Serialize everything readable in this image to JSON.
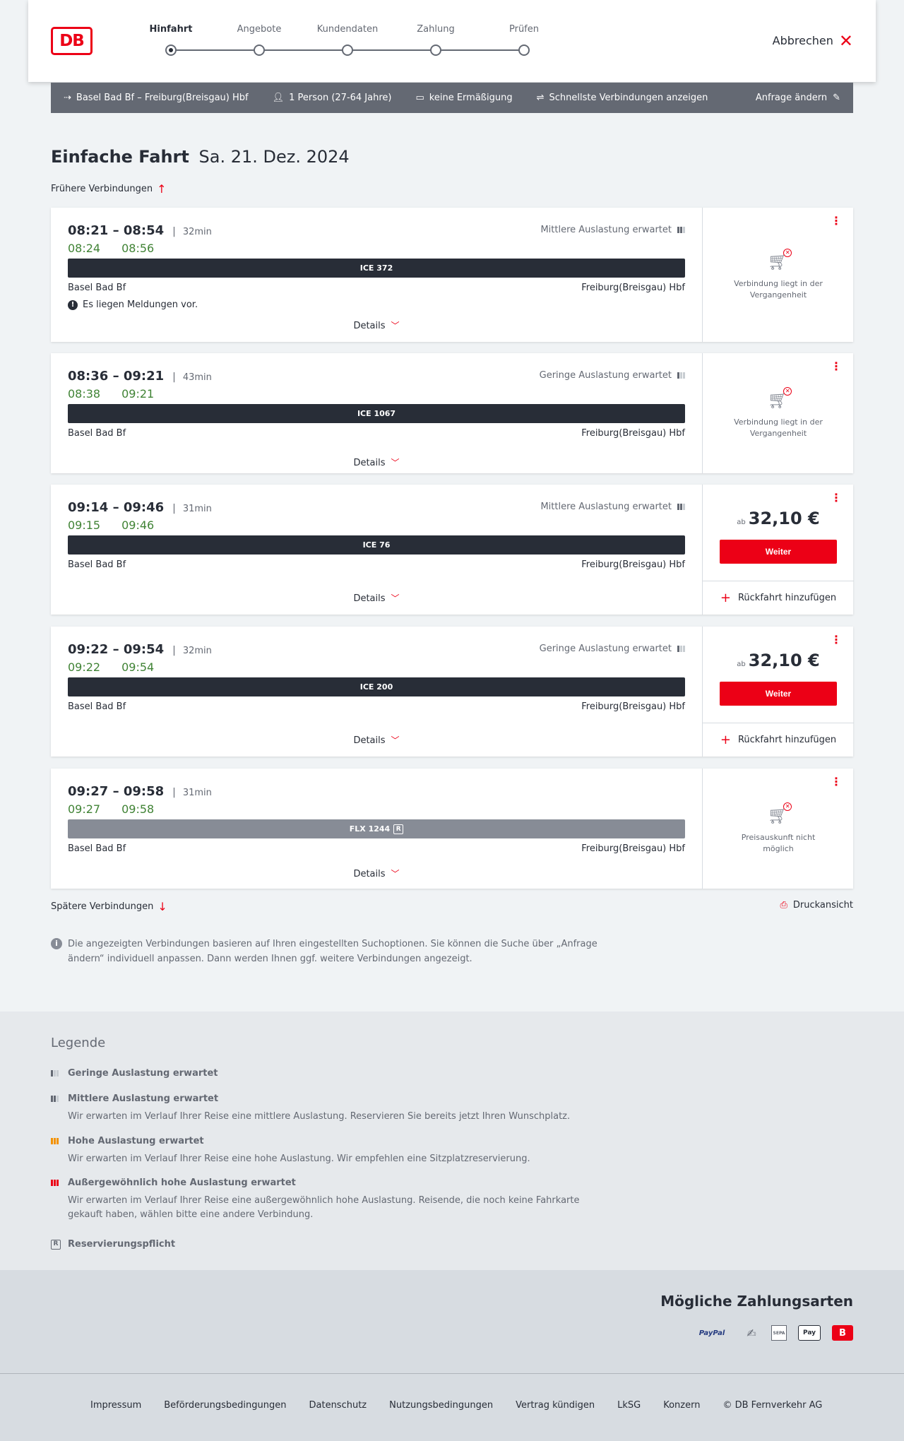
{
  "header": {
    "logo": "DB",
    "steps": [
      "Hinfahrt",
      "Angebote",
      "Kundendaten",
      "Zahlung",
      "Prüfen"
    ],
    "active_step": "Hinfahrt",
    "cancel_label": "Abbrechen"
  },
  "query": {
    "route": "Basel Bad Bf – Freiburg(Breisgau) Hbf",
    "persons": "1 Person (27-64 Jahre)",
    "discount": "keine Ermäßigung",
    "option": "Schnellste Verbindungen anzeigen",
    "edit_label": "Anfrage ändern"
  },
  "title": {
    "main": "Einfache Fahrt",
    "date": "Sa. 21. Dez. 2024"
  },
  "earlier_label": "Frühere Verbindungen",
  "later_label": "Spätere Verbindungen",
  "print_label": "Druckansicht",
  "connections": [
    {
      "times": "08:21 – 08:54",
      "duration": "32min",
      "rt_dep": "08:24",
      "rt_arr": "08:56",
      "load": "Mittlere Auslastung erwartet",
      "train": "ICE 372",
      "from": "Basel Bad Bf",
      "to": "Freiburg(Breisgau) Hbf",
      "message": "Es liegen Meldungen vor.",
      "details": "Details",
      "status_text": "Verbindung liegt in der Vergangenheit"
    },
    {
      "times": "08:36 – 09:21",
      "duration": "43min",
      "rt_dep": "08:38",
      "rt_arr": "09:21",
      "load": "Geringe Auslastung erwartet",
      "train": "ICE 1067",
      "from": "Basel Bad Bf",
      "to": "Freiburg(Breisgau) Hbf",
      "details": "Details",
      "status_text": "Verbindung liegt in der Vergangenheit"
    },
    {
      "times": "09:14 – 09:46",
      "duration": "31min",
      "rt_dep": "09:15",
      "rt_arr": "09:46",
      "load": "Mittlere Auslastung erwartet",
      "train": "ICE 76",
      "from": "Basel Bad Bf",
      "to": "Freiburg(Breisgau) Hbf",
      "details": "Details",
      "price_prefix": "ab",
      "price": "32,10 €",
      "button": "Weiter",
      "return": "Rückfahrt hinzufügen"
    },
    {
      "times": "09:22 – 09:54",
      "duration": "32min",
      "rt_dep": "09:22",
      "rt_arr": "09:54",
      "load": "Geringe Auslastung erwartet",
      "train": "ICE 200",
      "from": "Basel Bad Bf",
      "to": "Freiburg(Breisgau) Hbf",
      "details": "Details",
      "price_prefix": "ab",
      "price": "32,10 €",
      "button": "Weiter",
      "return": "Rückfahrt hinzufügen"
    },
    {
      "times": "09:27 – 09:58",
      "duration": "31min",
      "rt_dep": "09:27",
      "rt_arr": "09:58",
      "train": "FLX 1244",
      "reservation_mark": "R",
      "from": "Basel Bad Bf",
      "to": "Freiburg(Breisgau) Hbf",
      "details": "Details",
      "status_text": "Preisauskunft nicht möglich"
    }
  ],
  "info_text": "Die angezeigten Verbindungen basieren auf Ihren eingestellten Suchoptionen. Sie können die Suche über „Anfrage ändern“ individuell anpassen. Dann werden Ihnen ggf. weitere Verbindungen angezeigt.",
  "legend": {
    "title": "Legende",
    "items": [
      {
        "title": "Geringe Auslastung erwartet",
        "desc": ""
      },
      {
        "title": "Mittlere Auslastung erwartet",
        "desc": "Wir erwarten im Verlauf Ihrer Reise eine mittlere Auslastung. Reservieren Sie bereits jetzt Ihren Wunschplatz."
      },
      {
        "title": "Hohe Auslastung erwartet",
        "desc": "Wir erwarten im Verlauf Ihrer Reise eine hohe Auslastung. Wir empfehlen eine Sitzplatzreservierung."
      },
      {
        "title": "Außergewöhnlich hohe Auslastung erwartet",
        "desc": "Wir erwarten im Verlauf Ihrer Reise eine außergewöhnlich hohe Auslastung. Reisende, die noch keine Fahrkarte gekauft haben, wählen bitte eine andere Verbindung."
      },
      {
        "title": "Reservierungspflicht",
        "desc": ""
      }
    ]
  },
  "payment": {
    "title": "Mögliche Zahlungsarten",
    "methods": [
      "PayPal",
      "SEPA",
      "Pay",
      "B"
    ]
  },
  "footer": {
    "links": [
      "Impressum",
      "Beförderungsbedingungen",
      "Datenschutz",
      "Nutzungsbedingungen",
      "Vertrag kündigen",
      "LkSG",
      "Konzern",
      "© DB Fernverkehr AG"
    ]
  },
  "colors": {
    "db_red": "#ec0016",
    "realtime_green": "#408335",
    "dark": "#282d37",
    "gray": "#646973"
  }
}
